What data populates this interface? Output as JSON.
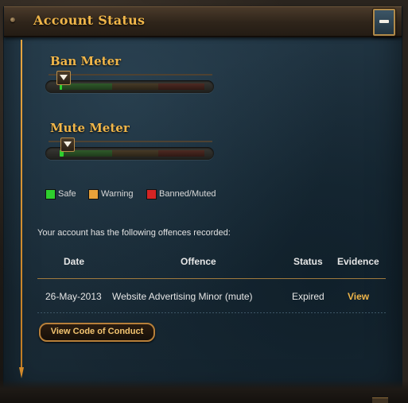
{
  "header": {
    "title": "Account Status",
    "collapse_label": "−"
  },
  "ban_meter": {
    "title": "Ban Meter",
    "level": 0
  },
  "mute_meter": {
    "title": "Mute Meter",
    "level": 0.03
  },
  "legend": [
    {
      "label": "Safe",
      "color": "#2ecf2e"
    },
    {
      "label": "Warning",
      "color": "#e8a23a"
    },
    {
      "label": "Banned/Muted",
      "color": "#d42424"
    }
  ],
  "offences": {
    "intro": "Your account has the following offences recorded:",
    "columns": [
      "Date",
      "Offence",
      "Status",
      "Evidence"
    ],
    "rows": [
      {
        "date": "26-May-2013",
        "offence": "Website Advertising Minor (mute)",
        "status": "Expired",
        "evidence": "View"
      }
    ]
  },
  "conduct_button": "View Code of Conduct"
}
